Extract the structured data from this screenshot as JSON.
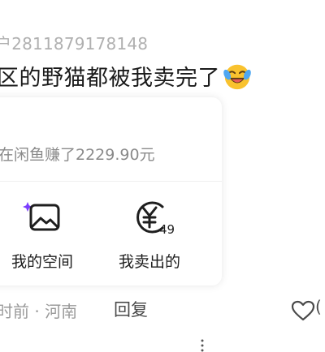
{
  "comment": {
    "username": "户2811879178148",
    "text": "区的野猫都被我卖完了",
    "emoji": "laughing-tears-emoji"
  },
  "card": {
    "earn_text": "在闲鱼赚了2229.90元",
    "tiles": [
      {
        "label": "我的空间",
        "icon": "image-sparkle-icon"
      },
      {
        "label": "我卖出的",
        "icon": "yuan-circle-icon",
        "badge": "49"
      }
    ],
    "more_icon": "more-dots-icon"
  },
  "footer": {
    "time_location": "时前 · 河南",
    "reply_label": "回复",
    "like_icon": "heart-icon",
    "like_extra": "(",
    "accent_color": "#7a3cff"
  }
}
